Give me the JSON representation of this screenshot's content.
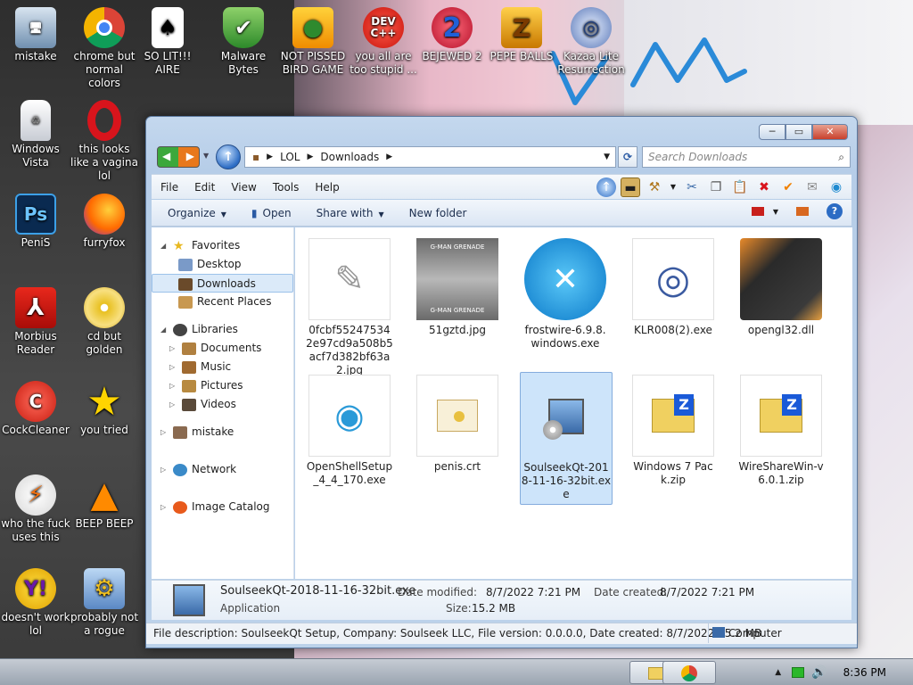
{
  "desktop": {
    "icons": [
      {
        "label": "mistake",
        "icon": "computer-icon"
      },
      {
        "label": "chrome but normal colors",
        "icon": "chrome-icon"
      },
      {
        "label": "SO LIT!!! AIRE",
        "icon": "solitaire-icon"
      },
      {
        "label": "Malware Bytes",
        "icon": "shield-icon"
      },
      {
        "label": "NOT PISSED BIRD GAME",
        "icon": "bird-game-icon"
      },
      {
        "label": "you all are too stupid ...",
        "icon": "devcpp-icon"
      },
      {
        "label": "BEJEWED 2",
        "icon": "bejeweled-icon"
      },
      {
        "label": "PEPE BALLS",
        "icon": "zuma-icon"
      },
      {
        "label": "Kazaa Lite Resurrection",
        "icon": "kazaa-icon"
      },
      {
        "label": "Windows Vista",
        "icon": "bin-icon"
      },
      {
        "label": "this looks like a vagina lol",
        "icon": "opera-icon"
      },
      {
        "label": "PeniS",
        "icon": "photoshop-icon"
      },
      {
        "label": "furryfox",
        "icon": "firefox-icon"
      },
      {
        "label": "Morbius Reader",
        "icon": "acrobat-icon"
      },
      {
        "label": "cd but golden",
        "icon": "cd-icon"
      },
      {
        "label": "CockCleaner",
        "icon": "ccleaner-icon"
      },
      {
        "label": "you tried",
        "icon": "star-icon"
      },
      {
        "label": "who the fuck uses this",
        "icon": "winamp-icon"
      },
      {
        "label": "BEEP BEEP",
        "icon": "vlc-icon"
      },
      {
        "label": "doesn't work lol",
        "icon": "yahoo-icon"
      },
      {
        "label": "probably not a rogue",
        "icon": "settings-icon"
      }
    ]
  },
  "window": {
    "address": {
      "segments": [
        "LOL",
        "Downloads"
      ]
    },
    "search_placeholder": "Search Downloads",
    "menu": [
      "File",
      "Edit",
      "View",
      "Tools",
      "Help"
    ],
    "commands": {
      "organize": "Organize",
      "open": "Open",
      "share": "Share with",
      "new_folder": "New folder"
    },
    "nav": {
      "favorites": "Favorites",
      "desktop": "Desktop",
      "downloads": "Downloads",
      "recent": "Recent Places",
      "libraries": "Libraries",
      "documents": "Documents",
      "music": "Music",
      "pictures": "Pictures",
      "videos": "Videos",
      "mistake": "mistake",
      "network": "Network",
      "image_catalog": "Image Catalog"
    },
    "files": [
      {
        "name": "0fcbf552475342e97cd9a508b5acf7d382bf63a2.jpg",
        "icon": "sketch-image-icon"
      },
      {
        "name": "51gztd.jpg",
        "icon": "photo-thumbnail-icon",
        "thumb_text_top": "G-MAN GRENADE",
        "thumb_text_bottom": "G-MAN GRENADE"
      },
      {
        "name": "frostwire-6.9.8.windows.exe",
        "icon": "frostwire-icon"
      },
      {
        "name": "KLR008(2).exe",
        "icon": "kazaa-icon"
      },
      {
        "name": "opengl32.dll",
        "icon": "dll-icon"
      },
      {
        "name": "OpenShellSetup_4_4_170.exe",
        "icon": "shell-icon"
      },
      {
        "name": "penis.crt",
        "icon": "certificate-icon"
      },
      {
        "name": "SoulseekQt-2018-11-16-32bit.exe",
        "icon": "installer-icon",
        "selected": true
      },
      {
        "name": "Windows 7 Pack.zip",
        "icon": "zip-icon"
      },
      {
        "name": "WireShareWin-v6.0.1.zip",
        "icon": "zip-icon"
      }
    ],
    "details": {
      "name": "SoulseekQt-2018-11-16-32bit.exe",
      "type": "Application",
      "modified_label": "Date modified:",
      "modified": "8/7/2022 7:21 PM",
      "created_label": "Date created:",
      "created": "8/7/2022 7:21 PM",
      "size_label": "Size:",
      "size": "15.2 MB"
    },
    "status": {
      "description": "File description: SoulseekQt Setup, Company: Soulseek LLC, File version: 0.0.0.0, Date created: 8/7/2022 15.2 MB",
      "location": "Computer"
    }
  },
  "taskbar": {
    "clock": "8:36 PM"
  }
}
